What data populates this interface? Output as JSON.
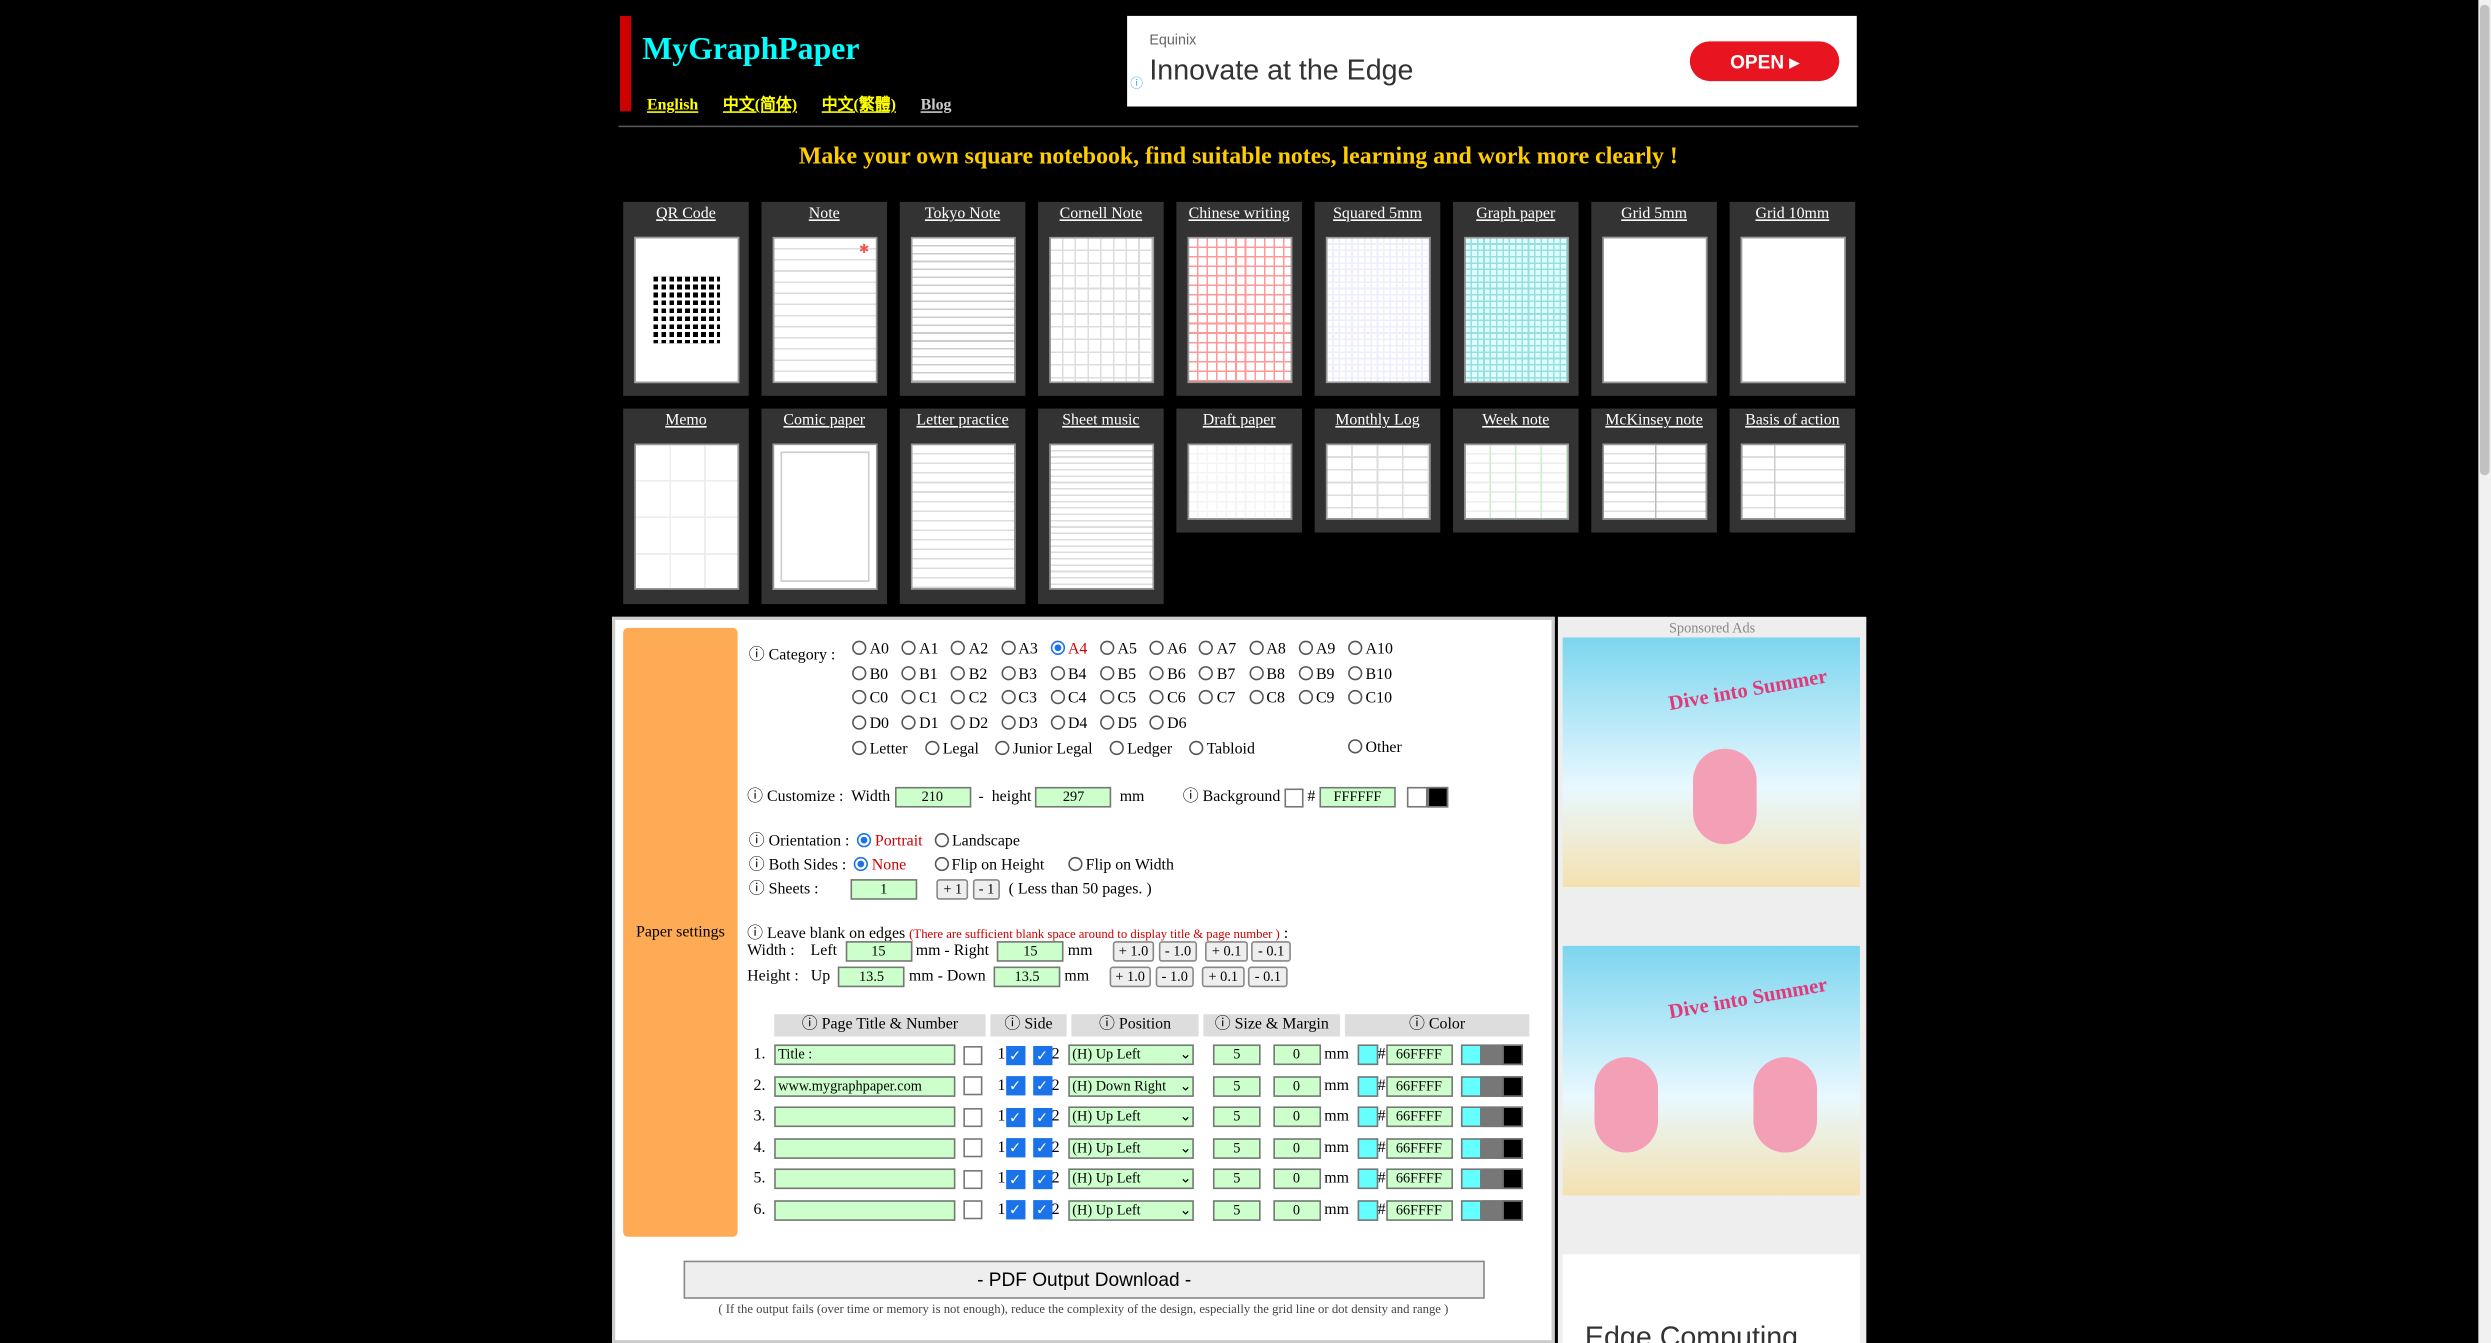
{
  "header": {
    "logo": "MyGraphPaper",
    "languages": [
      "English",
      "中文(简体)",
      "中文(繁體)",
      "Blog"
    ]
  },
  "ad_top": {
    "advertiser": "Equinix",
    "headline": "Innovate at the Edge",
    "button": "OPEN"
  },
  "slogan": "Make your own square notebook, find suitable notes, learning and work more clearly !",
  "templates_row1": [
    "QR Code",
    "Note",
    "Tokyo Note",
    "Cornell Note",
    "Chinese writing",
    "Squared 5mm",
    "Graph paper",
    "Grid 5mm",
    "Grid 10mm"
  ],
  "templates_row2": [
    "Memo",
    "Comic paper",
    "Letter practice",
    "Sheet music",
    "Draft paper",
    "Monthly Log",
    "Week note",
    "McKinsey note",
    "Basis of action"
  ],
  "settings": {
    "section_label": "Paper settings",
    "category_label": "Category :",
    "category_rows": [
      [
        "A0",
        "A1",
        "A2",
        "A3",
        "A4",
        "A5",
        "A6",
        "A7",
        "A8",
        "A9",
        "A10"
      ],
      [
        "B0",
        "B1",
        "B2",
        "B3",
        "B4",
        "B5",
        "B6",
        "B7",
        "B8",
        "B9",
        "B10"
      ],
      [
        "C0",
        "C1",
        "C2",
        "C3",
        "C4",
        "C5",
        "C6",
        "C7",
        "C8",
        "C9",
        "C10"
      ],
      [
        "D0",
        "D1",
        "D2",
        "D3",
        "D4",
        "D5",
        "D6"
      ],
      [
        "Letter",
        "Legal",
        "Junior Legal",
        "Ledger",
        "Tabloid"
      ]
    ],
    "category_other": "Other",
    "category_selected": "A4",
    "customize_label": "Customize :",
    "width_label": "Width",
    "width": "210",
    "dash": "-",
    "height_label": "height",
    "height": "297",
    "mm": "mm",
    "background_label": "Background",
    "hash": "#",
    "background": "FFFFFF",
    "orientation_label": "Orientation :",
    "orientation": [
      "Portrait",
      "Landscape"
    ],
    "both_sides_label": "Both Sides :",
    "both_sides": [
      "None",
      "Flip on Height",
      "Flip on Width"
    ],
    "sheets_label": "Sheets :",
    "sheets": "1",
    "plus1": "+ 1",
    "minus1": "- 1",
    "sheets_note": "( Less than 50 pages. )",
    "blank_label": "Leave blank on edges",
    "blank_note": "(There are sufficient blank space around to display title & page number )",
    "colon": ":",
    "width_row": "Width :",
    "left": "Left",
    "left_val": "15",
    "mm_right": "mm - Right",
    "right_val": "15",
    "height_row": "Height :",
    "up": "Up",
    "up_val": "13.5",
    "mm_down": "mm - Down",
    "down_val": "13.5",
    "steps_w": [
      "+ 1.0",
      "- 1.0",
      "+ 0.1",
      "- 0.1"
    ]
  },
  "table": {
    "headers": [
      "Page Title & Number",
      "Side",
      "Position",
      "Size & Margin",
      "Color"
    ],
    "rows": [
      {
        "n": "1.",
        "title": "Title :",
        "pos": "(H) Up Left"
      },
      {
        "n": "2.",
        "title": "www.mygraphpaper.com",
        "pos": "(H) Down Right"
      },
      {
        "n": "3.",
        "title": "",
        "pos": "(H) Up Left"
      },
      {
        "n": "4.",
        "title": "",
        "pos": "(H) Up Left"
      },
      {
        "n": "5.",
        "title": "",
        "pos": "(H) Up Left"
      },
      {
        "n": "6.",
        "title": "",
        "pos": "(H) Up Left"
      }
    ],
    "side1": "1",
    "side2": "2",
    "size": "5",
    "margin": "0",
    "color": "66FFFF"
  },
  "pdf": {
    "label": "- PDF Output Download -",
    "note": "( If the output fails (over time or memory is not enough), reduce the complexity of the design, especially the grid line or dot density and range )"
  },
  "sidebar": {
    "label": "Sponsored Ads",
    "ad_title": "Dive into Summer",
    "bottom_ad": "Edge Computing"
  }
}
